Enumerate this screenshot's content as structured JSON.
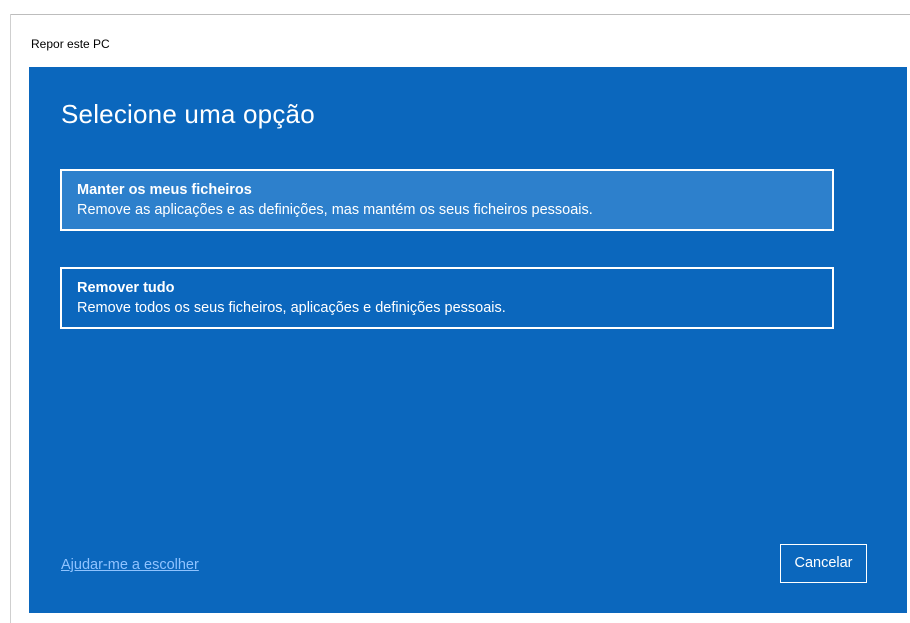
{
  "window": {
    "title": "Repor este PC"
  },
  "dialog": {
    "heading": "Selecione uma opção",
    "options": [
      {
        "title": "Manter os meus ficheiros",
        "description": "Remove as aplicações e as definições, mas mantém os seus ficheiros pessoais."
      },
      {
        "title": "Remover tudo",
        "description": "Remove todos os seus ficheiros, aplicações e definições pessoais."
      }
    ],
    "help_link": "Ajudar-me a escolher",
    "cancel_label": "Cancelar"
  },
  "colors": {
    "panel_background": "#0b67bd",
    "selected_option_background": "#2d80cc",
    "link": "#8fc3ff",
    "text": "#ffffff"
  }
}
